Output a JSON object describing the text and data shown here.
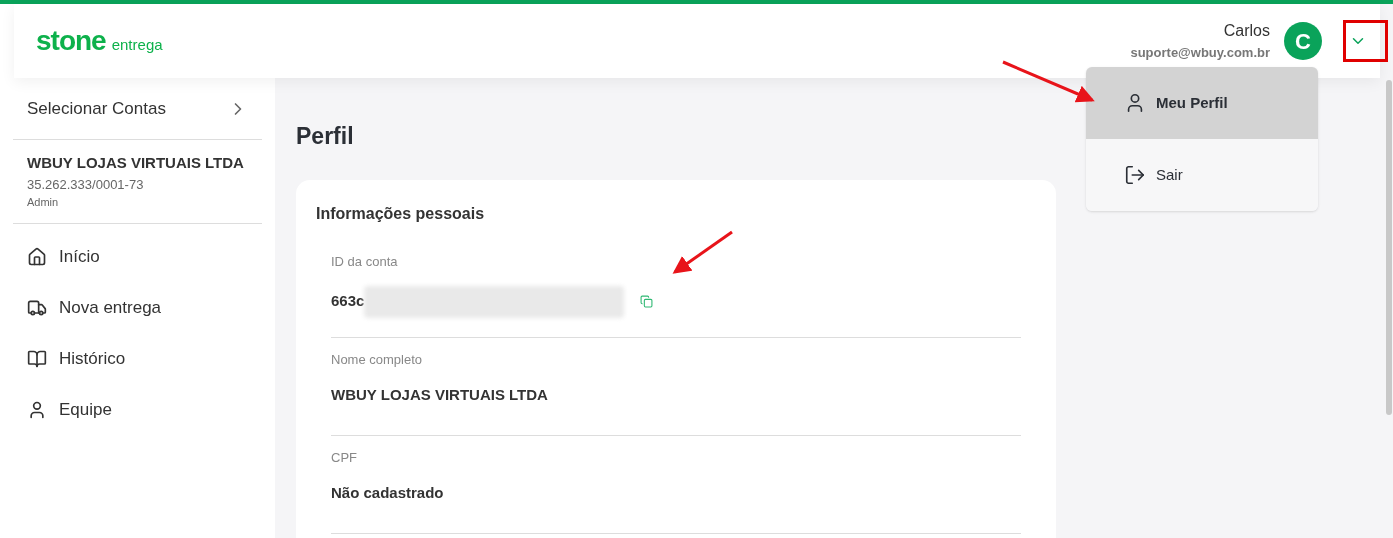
{
  "header": {
    "logo": {
      "brand": "stone",
      "product": "entrega"
    },
    "user": {
      "name": "Carlos",
      "email": "suporte@wbuy.com.br",
      "initial": "C"
    }
  },
  "user_menu": {
    "items": [
      {
        "kind": "profile",
        "label": "Meu Perfil",
        "selected": true
      },
      {
        "kind": "logout",
        "label": "Sair",
        "selected": false
      }
    ]
  },
  "sidebar": {
    "account_selector": "Selecionar Contas",
    "account": {
      "name": "WBUY LOJAS VIRTUAIS LTDA",
      "document": "35.262.333/0001-73",
      "role": "Admin"
    },
    "items": [
      {
        "kind": "home",
        "label": "Início"
      },
      {
        "kind": "truck",
        "label": "Nova entrega"
      },
      {
        "kind": "book",
        "label": "Histórico"
      },
      {
        "kind": "user",
        "label": "Equipe"
      }
    ]
  },
  "page": {
    "title": "Perfil",
    "card": {
      "title": "Informações pessoais",
      "fields": [
        {
          "label": "ID da conta",
          "value": "663c",
          "redacted": true,
          "kind": "copyable"
        },
        {
          "label": "Nome completo",
          "value": "WBUY LOJAS VIRTUAIS LTDA",
          "redacted": false,
          "kind": "plain"
        },
        {
          "label": "CPF",
          "value": "Não cadastrado",
          "redacted": false,
          "kind": "plain"
        }
      ]
    }
  }
}
